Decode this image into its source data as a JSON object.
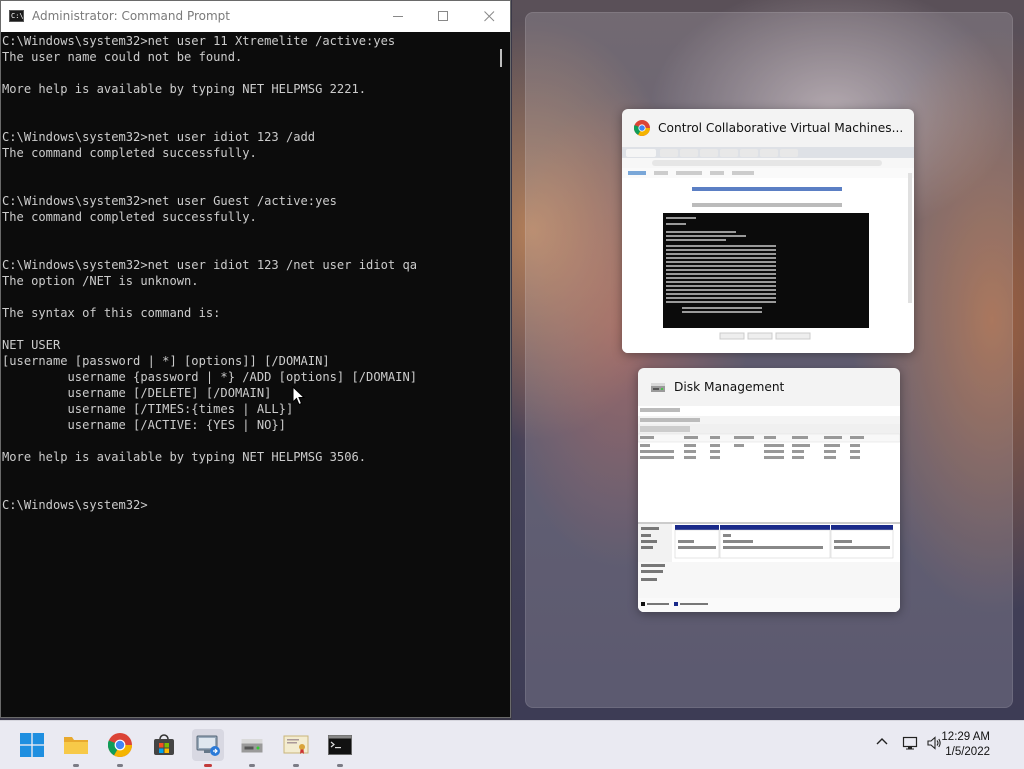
{
  "cmd": {
    "title": "Administrator: Command Prompt",
    "icon": "command-prompt-icon",
    "lines": [
      "C:\\Windows\\system32>net user 11 Xtremelite /active:yes",
      "The user name could not be found.",
      "",
      "More help is available by typing NET HELPMSG 2221.",
      "",
      "",
      "C:\\Windows\\system32>net user idiot 123 /add",
      "The command completed successfully.",
      "",
      "",
      "C:\\Windows\\system32>net user Guest /active:yes",
      "The command completed successfully.",
      "",
      "",
      "C:\\Windows\\system32>net user idiot 123 /net user idiot qa",
      "The option /NET is unknown.",
      "",
      "The syntax of this command is:",
      "",
      "NET USER",
      "[username [password | *] [options]] [/DOMAIN]",
      "         username {password | *} /ADD [options] [/DOMAIN]",
      "         username [/DELETE] [/DOMAIN]",
      "         username [/TIMES:{times | ALL}]",
      "         username [/ACTIVE: {YES | NO}]",
      "",
      "More help is available by typing NET HELPMSG 3506.",
      "",
      "",
      "C:\\Windows\\system32>"
    ]
  },
  "snap_thumbnails": [
    {
      "title": "Control Collaborative Virtual Machines...",
      "icon": "chrome-icon"
    },
    {
      "title": "Disk Management",
      "icon": "disk-management-icon"
    }
  ],
  "taskbar": {
    "icons": [
      {
        "name": "start-button",
        "icon": "windows-logo-icon",
        "active": false
      },
      {
        "name": "file-explorer-button",
        "icon": "folder-icon",
        "active": false
      },
      {
        "name": "chrome-button",
        "icon": "chrome-icon",
        "active": false
      },
      {
        "name": "microsoft-store-button",
        "icon": "store-icon",
        "active": false
      },
      {
        "name": "remote-desktop-button",
        "icon": "remote-desktop-icon",
        "active": true
      },
      {
        "name": "disk-management-button",
        "icon": "disk-management-icon",
        "active": false
      },
      {
        "name": "certificate-manager-button",
        "icon": "certificate-icon",
        "active": false
      },
      {
        "name": "command-prompt-button",
        "icon": "command-prompt-icon",
        "active": false
      }
    ],
    "time": "12:29 AM",
    "date": "1/5/2022"
  },
  "colors": {
    "console_bg": "#0c0c0c",
    "console_fg": "#cccccc",
    "taskbar_bg": "#eaeaf2",
    "active_indicator": "#c23b3b"
  }
}
